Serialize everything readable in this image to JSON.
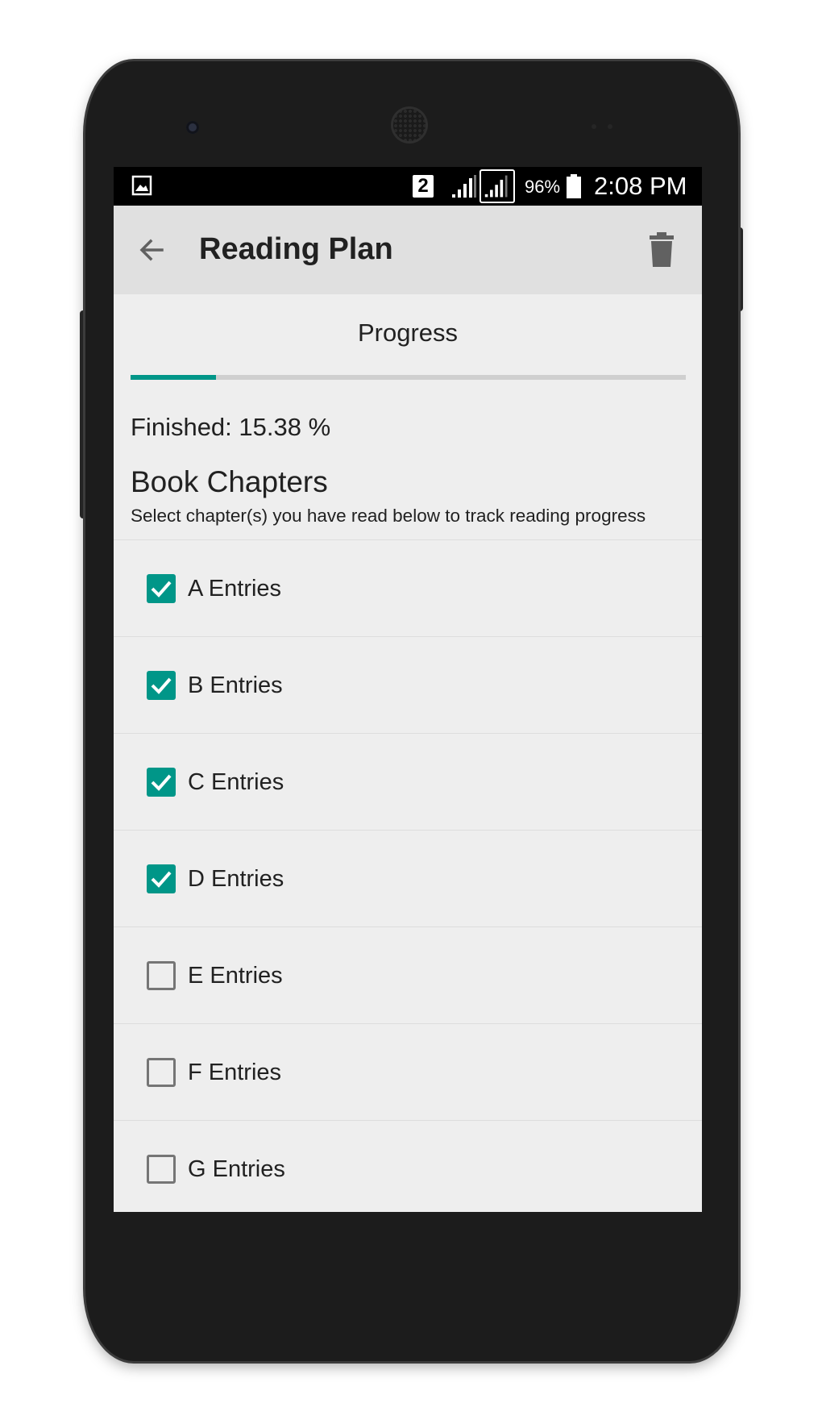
{
  "status_bar": {
    "sim_slot": "2",
    "battery_percent": "96%",
    "time": "2:08 PM"
  },
  "toolbar": {
    "title": "Reading Plan"
  },
  "progress": {
    "heading": "Progress",
    "fraction": 0.1538,
    "finished_text": "Finished: 15.38 %",
    "accent_color": "#009688"
  },
  "chapters": {
    "title": "Book Chapters",
    "subtitle": "Select chapter(s) you have read below to track reading progress",
    "items": [
      {
        "label": "A Entries",
        "checked": true
      },
      {
        "label": "B Entries",
        "checked": true
      },
      {
        "label": "C Entries",
        "checked": true
      },
      {
        "label": "D Entries",
        "checked": true
      },
      {
        "label": "E Entries",
        "checked": false
      },
      {
        "label": "F Entries",
        "checked": false
      },
      {
        "label": "G Entries",
        "checked": false
      }
    ]
  },
  "icons": {
    "status_left": "image-icon",
    "signal": "signal-icon",
    "battery": "battery-icon",
    "back": "arrow-back-icon",
    "delete": "trash-icon",
    "check": "check-icon"
  }
}
